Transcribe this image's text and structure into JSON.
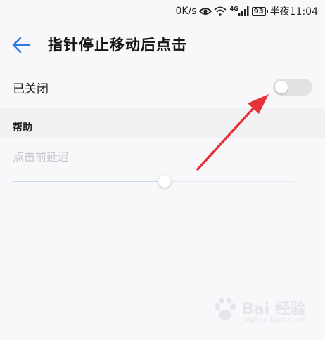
{
  "status_bar": {
    "speed": "0K/s",
    "network_gen": "4G",
    "battery": "93",
    "time": "半夜11:04"
  },
  "header": {
    "title": "指针停止移动后点击",
    "back_icon": "arrow-left-icon"
  },
  "toggle": {
    "label": "已关闭",
    "state": "off"
  },
  "section": {
    "title": "帮助"
  },
  "delay": {
    "label": "点击前延迟",
    "value_fraction": 0.54
  },
  "watermark": {
    "text": "Bai 经验",
    "sub": "jingyan.baidu.com"
  },
  "colors": {
    "accent": "#2f7ae5",
    "arrow": "#e8323b",
    "background": "#f8f8fa",
    "section_band": "#f1f1f3"
  }
}
